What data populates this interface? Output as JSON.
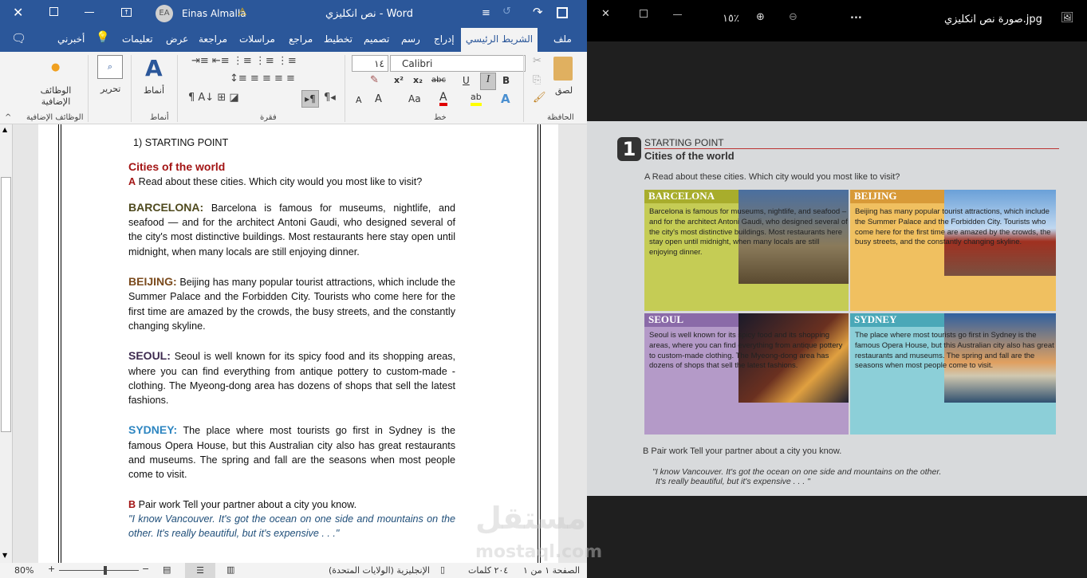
{
  "word": {
    "title": "نص انكليزي  -  Word",
    "user": "Einas Almalla",
    "user_initials": "EA",
    "tabs": [
      "ملف",
      "الشريط الرئيسي",
      "إدراج",
      "رسم",
      "تصميم",
      "تخطيط",
      "مراجع",
      "مراسلات",
      "مراجعة",
      "عرض",
      "تعليمات",
      "أخبرني"
    ],
    "ribbon": {
      "paste": "لصق",
      "clipboard": "الحافظة",
      "font_size": "١٤",
      "font_name": "Calibri",
      "font": "خط",
      "paragraph": "فقرة",
      "styles": "أنماط",
      "styles_group": "أنماط",
      "editing": "تحرير",
      "addins": "الوظائف الإضافية",
      "addins_group": "الوظائف الإضافية",
      "bold": "B",
      "italic": "I",
      "underline": "U",
      "strike": "abc",
      "sub": "x₂",
      "sup": "x²",
      "case": "Aa",
      "grow": "A",
      "shrink": "A"
    },
    "document": {
      "heading_num": "1)  STARTING POINT",
      "title": "Cities of the world",
      "instruction_letter": "A",
      "instruction": "Read about these cities. Which city would you most like to visit?",
      "cities": [
        {
          "name": "BARCELONA:",
          "color": "#4f4a1e",
          "text": "Barcelona is famous for museums, nightlife, and seafood — and for the architect Antoni Gaudi, who designed several of the city's most distinctive buildings. Most restaurants here stay open until midnight, when many locals are still enjoying dinner."
        },
        {
          "name": "BEIJING:",
          "color": "#7a4a1c",
          "text": "Beijing has many popular tourist attractions, which include the Summer Palace and the Forbidden City. Tourists who come here for the first time are amazed by the crowds, the busy streets, and the constantly changing skyline."
        },
        {
          "name": "SEOUL:",
          "color": "#3d2a4f",
          "text": "Seoul is well known for its spicy food and its shopping areas, where you can find everything from antique pottery to custom-made -clothing. The Myeong-dong area has dozens of shops that sell the latest fashions."
        },
        {
          "name": "SYDNEY:",
          "color": "#2e86c1",
          "text": "The place where most tourists go first in Sydney is the famous Opera House, but this Australian city also has great restaurants and museums. The spring and fall are the seasons when most people come to visit."
        }
      ],
      "pair_letter": "B",
      "pair": "Pair work Tell your partner about a city you know.",
      "quote": "\"I know Vancouver. It's got the ocean on one side and mountains on the other. It's really beautiful, but it's expensive . . .\""
    },
    "status": {
      "page": "الصفحة ١ من ١",
      "words": "٢٠٤ كلمات",
      "language": "الإنجليزية (الولايات المتحدة)",
      "zoom": "80%"
    }
  },
  "viewer": {
    "title": "صورة نص انكليزي.jpg",
    "zoom": "١٥٪",
    "more": "...",
    "book": {
      "number": "1",
      "section": "STARTING POINT",
      "title": "Cities of the world",
      "instruction": "A  Read about these cities. Which city would you most like to visit?",
      "boxes": [
        {
          "name": "BARCELONA",
          "text": "Barcelona is famous for museums, nightlife, and seafood – and for the architect Antoni Gaudi, who designed several of the city's most distinctive buildings. Most restaurants here stay open until midnight, when many locals are still enjoying dinner.",
          "color": "#b7bf3a"
        },
        {
          "name": "BEIJING",
          "text": "Beijing has many popular tourist attractions, which include the Summer Palace and the Forbidden City. Tourists who come here for the first time are amazed by the crowds, the busy streets, and the constantly changing skyline.",
          "color": "#e8b54a"
        },
        {
          "name": "SEOUL",
          "text": "Seoul is well known for its spicy food and its shopping areas, where you can find everything from antique pottery to custom-made clothing. The Myeong-dong area has dozens of shops that sell the latest fashions.",
          "color": "#a98cc0"
        },
        {
          "name": "SYDNEY",
          "text": "The place where most tourists go first in Sydney is the famous Opera House, but this Australian city also has great restaurants and museums. The spring and fall are the seasons when most people come to visit.",
          "color": "#7cc3cf"
        }
      ],
      "pair": "B  Pair work  Tell your partner about a city you know.",
      "quote1": "\"I know Vancouver. It's got the ocean on one side and mountains on the other.",
      "quote2": "It's really beautiful, but it's expensive . . . \""
    },
    "watermark": "مستقل",
    "watermark_latin": "mostaql.com"
  },
  "colors": {
    "word_blue": "#2b579a",
    "title_red": "#a31515",
    "quote_blue": "#1f4e79"
  }
}
